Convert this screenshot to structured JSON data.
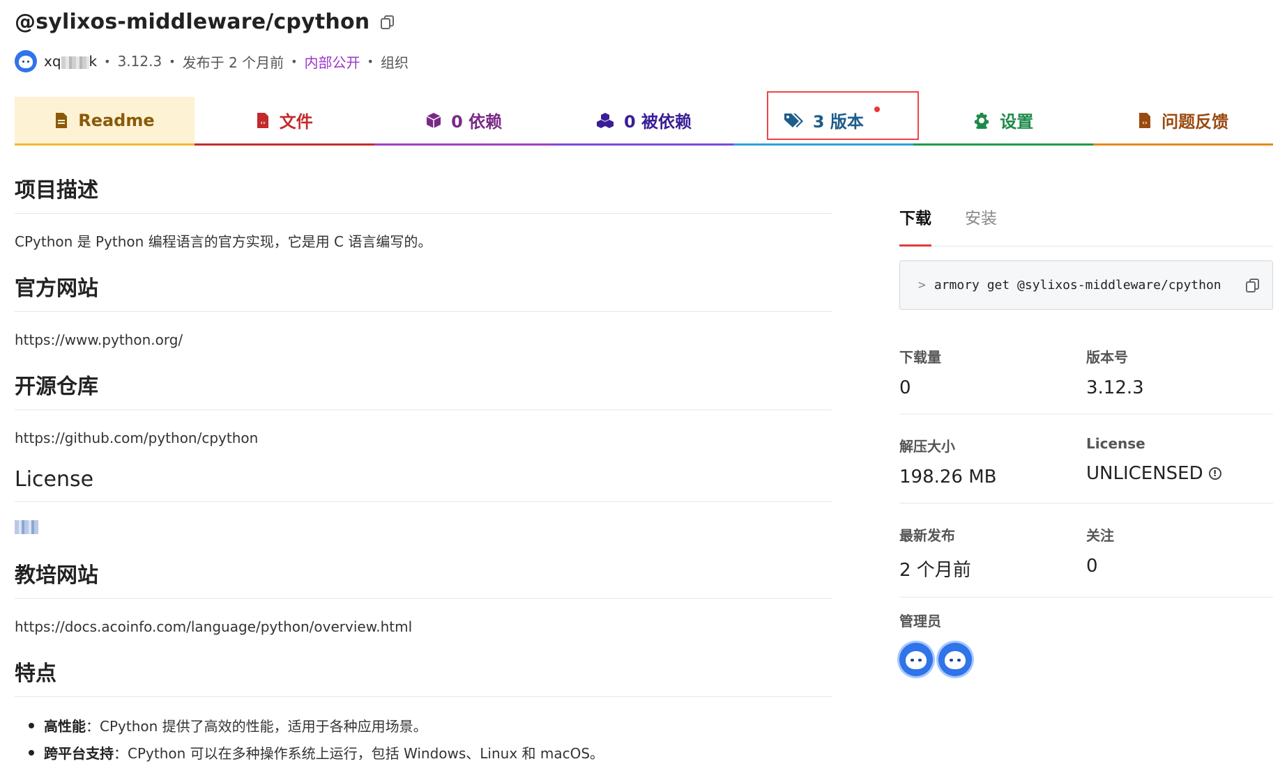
{
  "package": {
    "name": "@sylixos-middleware/cpython",
    "user": "xq",
    "user_suffix": "k",
    "version": "3.12.3",
    "published": "发布于 2 个月前",
    "access": "内部公开",
    "scope": "组织"
  },
  "tabs": [
    {
      "label": "Readme",
      "icon": "document-icon"
    },
    {
      "label": "文件",
      "icon": "code-file-icon"
    },
    {
      "label": "0 依赖",
      "icon": "cube-icon"
    },
    {
      "label": "0 被依赖",
      "icon": "cubes-icon"
    },
    {
      "label": "3 版本",
      "icon": "tags-icon"
    },
    {
      "label": "设置",
      "icon": "gear-icon"
    },
    {
      "label": "问题反馈",
      "icon": "code-file-icon"
    }
  ],
  "readme": {
    "desc_title": "项目描述",
    "desc_text": "CPython 是 Python 编程语言的官方实现，它是用 C 语言编写的。",
    "site_title": "官方网站",
    "site_url": "https://www.python.org/",
    "repo_title": "开源仓库",
    "repo_url": "https://github.com/python/cpython",
    "license_title": "License",
    "training_title": "教培网站",
    "training_url": "https://docs.acoinfo.com/language/python/overview.html",
    "features_title": "特点",
    "features": [
      {
        "name": "高性能",
        "text": "：CPython 提供了高效的性能，适用于各种应用场景。"
      },
      {
        "name": "跨平台支持",
        "text": "：CPython 可以在多种操作系统上运行，包括 Windows、Linux 和 macOS。"
      }
    ]
  },
  "sidebar": {
    "tab_download": "下载",
    "tab_install": "安装",
    "command": "armory get @sylixos-middleware/cpython",
    "downloads_label": "下载量",
    "downloads": "0",
    "version_label": "版本号",
    "version": "3.12.3",
    "size_label": "解压大小",
    "size": "198.26 MB",
    "license_label": "License",
    "license": "UNLICENSED",
    "latest_label": "最新发布",
    "latest": "2 个月前",
    "follow_label": "关注",
    "follow": "0",
    "admins_label": "管理员"
  },
  "colors": {
    "access": "#9b35c9",
    "active_tab_underline": "#e23b3b",
    "highlight_box": "#ee4444"
  }
}
